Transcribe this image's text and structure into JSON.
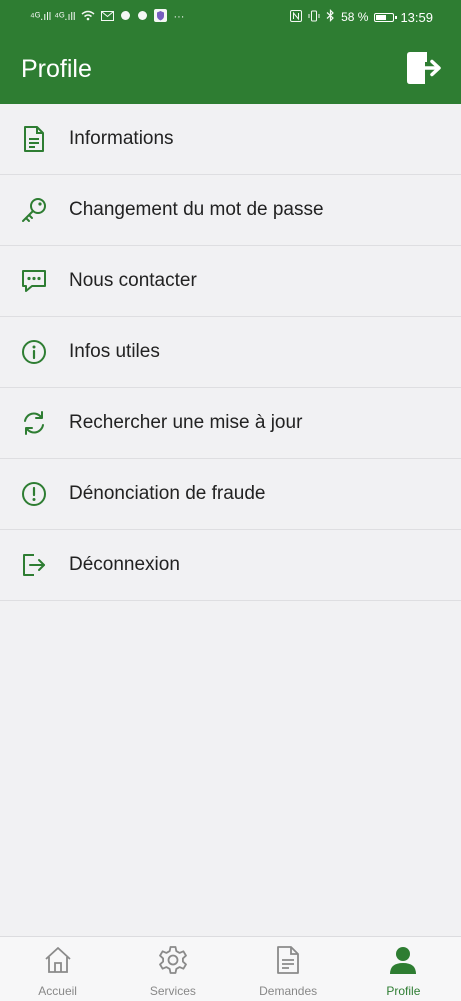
{
  "status_bar": {
    "left_text": "⁴ᴳ.ıll ⁴ᴳ.ıll",
    "battery": "58 %",
    "time": "13:59"
  },
  "header": {
    "title": "Profile",
    "action_icon": "logout-icon"
  },
  "menu": {
    "items": [
      {
        "label": "Informations",
        "icon": "document-icon"
      },
      {
        "label": "Changement du mot de passe",
        "icon": "key-icon"
      },
      {
        "label": "Nous contacter",
        "icon": "chat-icon"
      },
      {
        "label": "Infos utiles",
        "icon": "info-icon"
      },
      {
        "label": "Rechercher une mise à jour",
        "icon": "refresh-icon"
      },
      {
        "label": "Dénonciation de fraude",
        "icon": "alert-icon"
      },
      {
        "label": "Déconnexion",
        "icon": "logout-icon"
      }
    ]
  },
  "bottom_nav": {
    "items": [
      {
        "label": "Accueil",
        "icon": "home-icon",
        "active": false
      },
      {
        "label": "Services",
        "icon": "gear-icon",
        "active": false
      },
      {
        "label": "Demandes",
        "icon": "document-icon",
        "active": false
      },
      {
        "label": "Profile",
        "icon": "person-icon",
        "active": true
      }
    ]
  },
  "colors": {
    "primary": "#2e7d32",
    "background": "#f1f1f3",
    "inactive": "#888888"
  }
}
